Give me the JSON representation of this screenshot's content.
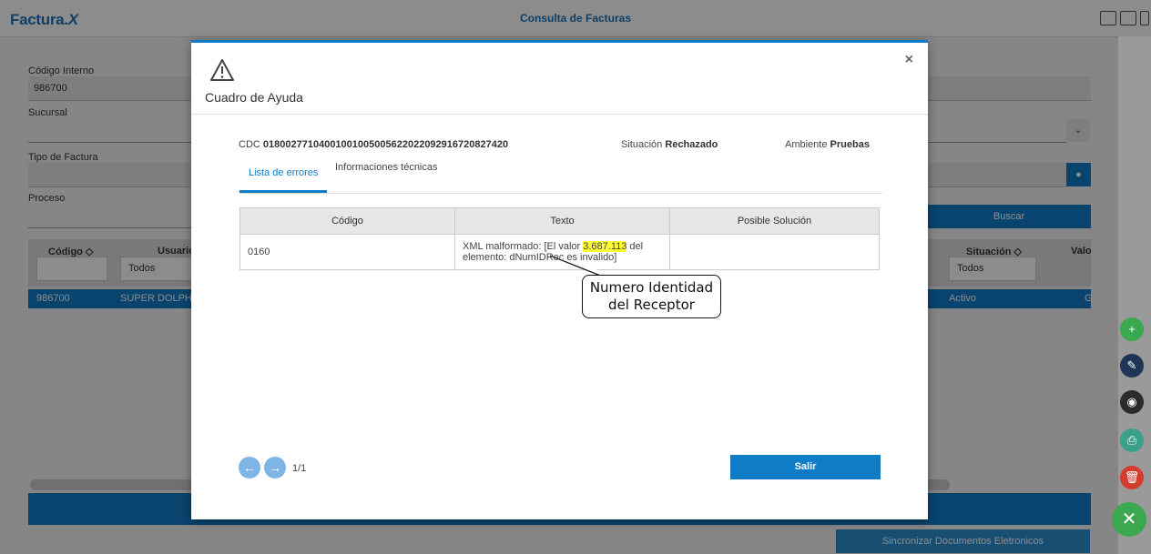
{
  "app": {
    "logo_main": "Factura",
    "logo_x": "X",
    "page_title": "Consulta de Facturas"
  },
  "background": {
    "codigo_interno_label": "Código Interno",
    "codigo_interno_value": "986700",
    "sucursal_label": "Sucursal",
    "tipo_factura_label": "Tipo de Factura",
    "proceso_label": "Proceso",
    "buscar_label": "Buscar",
    "col_codigo": "Código ◇",
    "col_usuario": "Usuario",
    "col_situacion": "Situación ◇",
    "col_valor": "Valo",
    "filter_todos": "Todos",
    "filter_todos_2": "Todos",
    "row_codigo": "986700",
    "row_usuario": "SUPER DOLPHIN",
    "row_situacion": "Activo",
    "row_valor": "G",
    "sync_label": "Sincronizar Documentos Eletronicos"
  },
  "modal": {
    "title": "Cuadro de Ayuda",
    "close_label": "×",
    "cdc_label": "CDC",
    "cdc_value": "01800277104001001005005622022092916720827420",
    "situacion_label": "Situación",
    "situacion_value": "Rechazado",
    "ambiente_label": "Ambiente",
    "ambiente_value": "Pruebas",
    "tabs": [
      {
        "label": "Lista de errores",
        "active": true
      },
      {
        "label": "Informaciones técnicas",
        "active": false
      }
    ],
    "table": {
      "headers": [
        "Código",
        "Texto",
        "Posible Solución"
      ],
      "row": {
        "codigo": "0160",
        "texto_pre": "XML malformado: [El valor ",
        "texto_highlight": "3.687.113",
        "texto_post": " del elemento: dNumIDRec es invalido]",
        "solucion": ""
      }
    },
    "callout_text_1": "Numero Identidad",
    "callout_text_2": "del Receptor",
    "pager_text": "1/1",
    "salir_label": "Salir"
  },
  "colors": {
    "accent": "#0f7cc7",
    "highlight": "#ffff33"
  }
}
